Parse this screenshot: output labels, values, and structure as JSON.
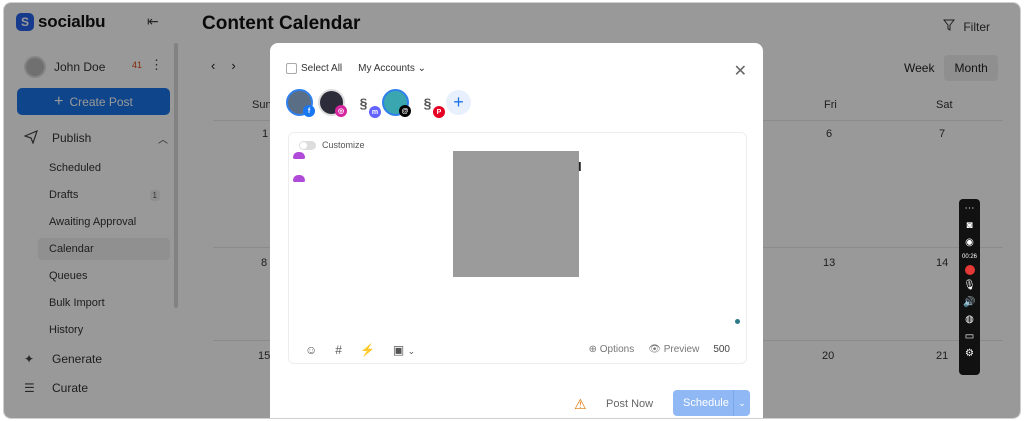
{
  "brand": {
    "name": "socialbu",
    "mark": "S"
  },
  "user": {
    "name": "John Doe",
    "notification_count": "41"
  },
  "sidebar": {
    "create_post_label": "Create Post",
    "publish_label": "Publish",
    "items": [
      {
        "label": "Scheduled"
      },
      {
        "label": "Drafts",
        "count": "1"
      },
      {
        "label": "Awaiting Approval"
      },
      {
        "label": "Calendar"
      },
      {
        "label": "Queues"
      },
      {
        "label": "Bulk Import"
      },
      {
        "label": "History"
      }
    ],
    "generate_label": "Generate",
    "curate_label": "Curate"
  },
  "page": {
    "title": "Content Calendar",
    "filter_label": "Filter",
    "view_options": [
      "Week",
      "Month"
    ],
    "selected_view": "Month"
  },
  "calendar": {
    "day_names": {
      "sun": "Sun",
      "fri": "Fri",
      "sat": "Sat"
    },
    "dates": {
      "r1_sun": "1",
      "r1_fri": "6",
      "r1_sat": "7",
      "r2_sun": "8",
      "r2_fri": "13",
      "r2_sat": "14",
      "r3_sun": "15",
      "r3_fri": "20",
      "r3_sat": "21"
    }
  },
  "composer": {
    "select_all_label": "Select All",
    "accounts_dropdown_label": "My Accounts",
    "customize_label": "Customize",
    "options_label": "Options",
    "preview_label": "Preview",
    "char_count": "500",
    "post_now_label": "Post Now",
    "schedule_label": "Schedule",
    "accounts": [
      {
        "network": "facebook",
        "color": "#1877f2",
        "avatar_color": "#5a6f86"
      },
      {
        "network": "instagram",
        "color": "#d6249f",
        "avatar_color": "#2b2b3a"
      },
      {
        "network": "mastodon",
        "color": "#6364ff"
      },
      {
        "network": "threads",
        "color": "#000000",
        "avatar_color": "#3aa6b0"
      },
      {
        "network": "pinterest",
        "color": "#e60023"
      }
    ]
  },
  "recorder": {
    "time": "00:26"
  },
  "colors": {
    "accent": "#1a73e8",
    "schedule_disabled": "#8fb8f5",
    "recorder_bg": "#111111"
  }
}
